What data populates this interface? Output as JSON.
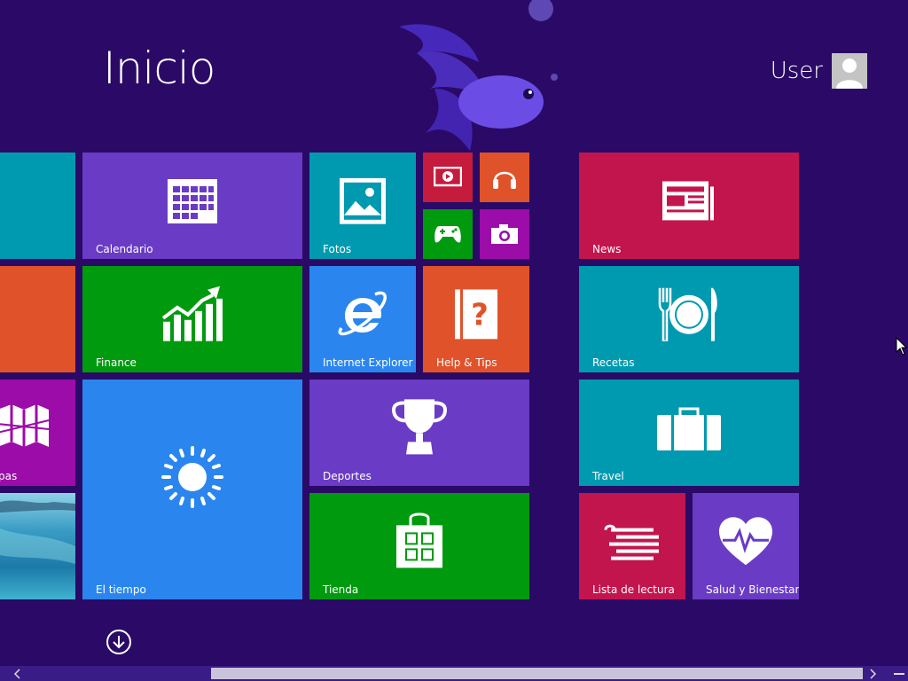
{
  "start": {
    "title": "Inicio"
  },
  "user": {
    "name": "User"
  },
  "tiles": {
    "partial_teal": {
      "label": ""
    },
    "calendar": {
      "label": "Calendario"
    },
    "photos": {
      "label": "Fotos"
    },
    "video": {
      "label": ""
    },
    "music": {
      "label": ""
    },
    "games": {
      "label": ""
    },
    "camera": {
      "label": ""
    },
    "news": {
      "label": "News"
    },
    "partial_orange": {
      "label": ""
    },
    "finance": {
      "label": "Finance"
    },
    "ie": {
      "label": "Internet Explorer"
    },
    "help": {
      "label": "Help & Tips"
    },
    "recipes": {
      "label": "Recetas"
    },
    "maps": {
      "label": "pas"
    },
    "weather": {
      "label": "El tiempo"
    },
    "sports": {
      "label": "Deportes"
    },
    "travel": {
      "label": "Travel"
    },
    "desktop": {
      "label": ""
    },
    "store": {
      "label": "Tienda"
    },
    "reading": {
      "label": "Lista de lectura"
    },
    "health": {
      "label": "Salud y Bienestar"
    }
  },
  "colors": {
    "background": "#2a0a66",
    "teal": "#009ab0",
    "orange": "#e0522a",
    "magenta": "#9c0ca8",
    "purple": "#6a3bc4",
    "green": "#009a0e",
    "blue": "#2a86ee",
    "crimson": "#c3154d",
    "red": "#c51b3c"
  }
}
